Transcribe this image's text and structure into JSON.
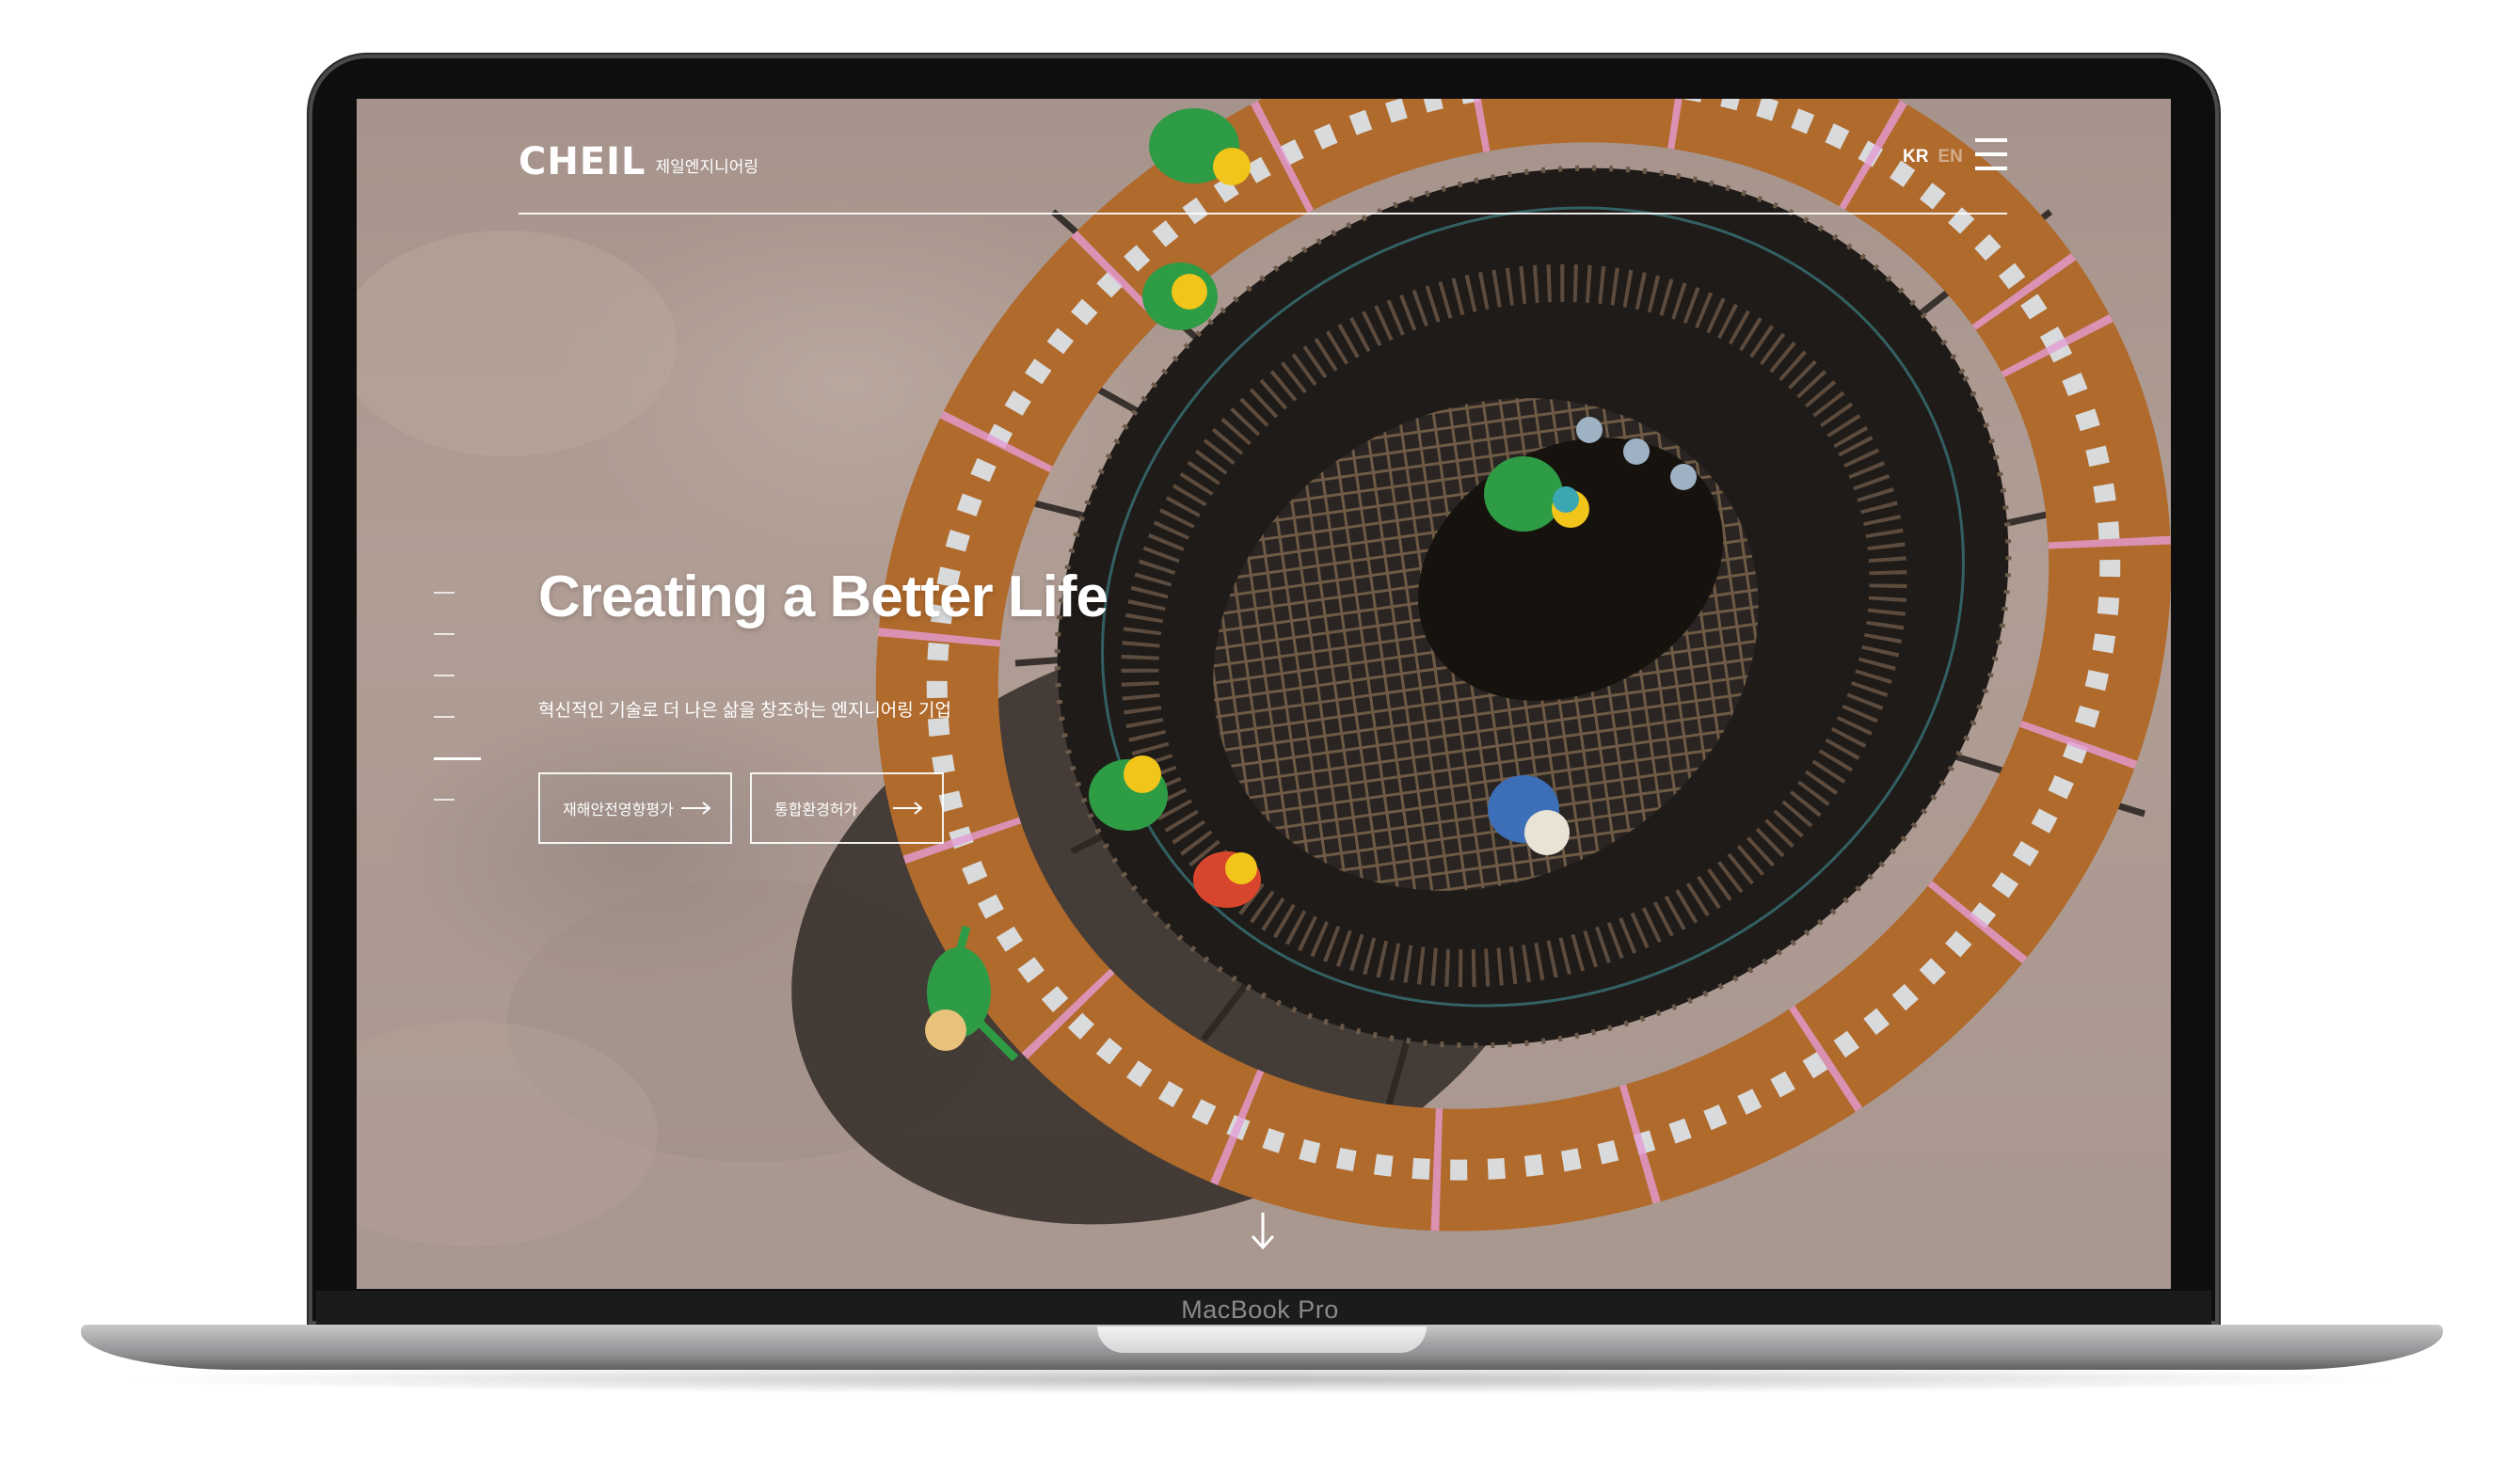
{
  "device": {
    "brand_label": "MacBook Pro"
  },
  "header": {
    "logo_word": "CHEIL",
    "logo_sub": "제일엔지니어링",
    "lang_kr": "KR",
    "lang_en": "EN",
    "menu_icon": "hamburger-icon"
  },
  "pager": {
    "count": 6,
    "active_index": 4
  },
  "hero": {
    "title": "Creating a Better Life",
    "subtitle": "혁신적인 기술로 더 나은 삶을 창조하는 엔지니어링 기업",
    "buttons": [
      {
        "label": "재해안전영향평가",
        "icon": "arrow-right-icon"
      },
      {
        "label": "통합환경허가",
        "icon": "arrow-right-icon"
      }
    ]
  },
  "scroll_icon": "arrow-down-icon",
  "colors": {
    "text": "#ffffff",
    "ground": "#a89790",
    "rust": "#b8702e",
    "worker_green": "#2e9b45",
    "helmet_yellow": "#f2c51a"
  }
}
